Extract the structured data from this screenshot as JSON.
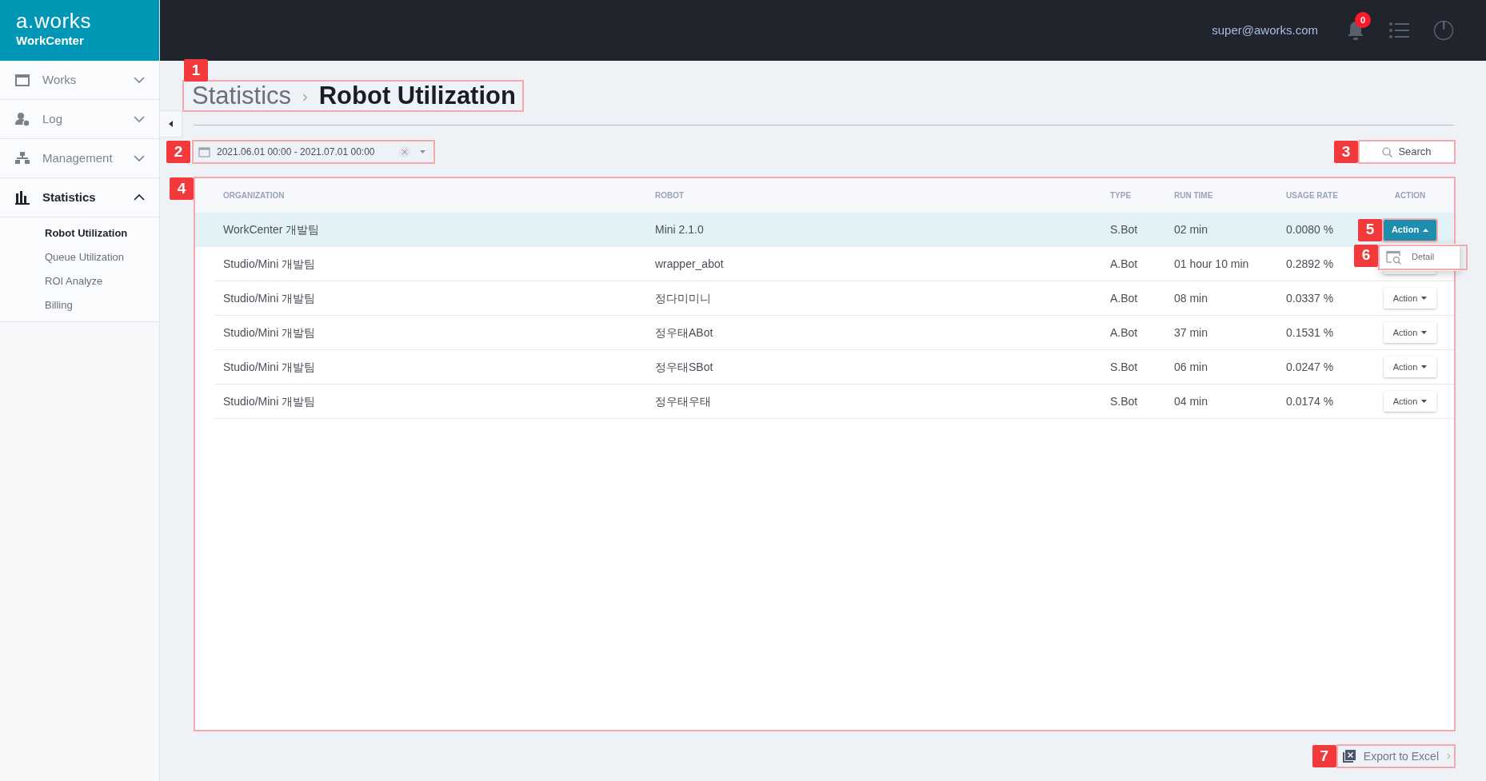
{
  "brand": {
    "logo": "a.works",
    "product": "WorkCenter"
  },
  "header": {
    "user": "super@aworks.com",
    "notifications": "0"
  },
  "sidebar": {
    "items": [
      {
        "label": "Works",
        "kind": "calendar",
        "expanded": false,
        "selected": false
      },
      {
        "label": "Log",
        "kind": "user",
        "expanded": false,
        "selected": false
      },
      {
        "label": "Management",
        "kind": "tree",
        "expanded": false,
        "selected": false
      },
      {
        "label": "Statistics",
        "kind": "chart",
        "expanded": true,
        "selected": true,
        "children": [
          {
            "label": "Robot Utilization",
            "selected": true
          },
          {
            "label": "Queue Utilization",
            "selected": false
          },
          {
            "label": "ROI Analyze",
            "selected": false
          },
          {
            "label": "Billing",
            "selected": false
          }
        ]
      }
    ]
  },
  "breadcrumb": {
    "parent": "Statistics",
    "separator": "›",
    "current": "Robot Utilization",
    "annotation": "1"
  },
  "date_range": {
    "value": "2021.06.01 00:00 - 2021.07.01 00:00",
    "annotation": "2"
  },
  "search_button": {
    "label": "Search",
    "annotation": "3"
  },
  "table": {
    "annotation": "4",
    "columns": [
      "ORGANIZATION",
      "ROBOT",
      "TYPE",
      "RUN TIME",
      "USAGE RATE",
      "ACTION"
    ],
    "rows": [
      {
        "cells": [
          "WorkCenter 개발팀",
          "Mini 2.1.0",
          "S.Bot",
          "02 min",
          "0.0080 %"
        ],
        "selected": true,
        "action": {
          "label": "Action",
          "expanded": true,
          "annotation": "5",
          "menu": [
            {
              "label": "Detail",
              "annotation": "6"
            }
          ]
        }
      },
      {
        "cells": [
          "Studio/Mini 개발팀",
          "wrapper_abot",
          "A.Bot",
          "01 hour 10 min",
          "0.2892 %"
        ],
        "selected": false,
        "action": {
          "expanded": false
        }
      },
      {
        "cells": [
          "Studio/Mini 개발팀",
          "정다미미니",
          "A.Bot",
          "08 min",
          "0.0337 %"
        ],
        "selected": false,
        "action": {
          "label": "Action",
          "expanded": false
        }
      },
      {
        "cells": [
          "Studio/Mini 개발팀",
          "정우태ABot",
          "A.Bot",
          "37 min",
          "0.1531 %"
        ],
        "selected": false,
        "action": {
          "label": "Action",
          "expanded": false
        }
      },
      {
        "cells": [
          "Studio/Mini 개발팀",
          "정우태SBot",
          "S.Bot",
          "06 min",
          "0.0247 %"
        ],
        "selected": false,
        "action": {
          "label": "Action",
          "expanded": false
        }
      },
      {
        "cells": [
          "Studio/Mini 개발팀",
          "정우태우태",
          "S.Bot",
          "04 min",
          "0.0174 %"
        ],
        "selected": false,
        "action": {
          "label": "Action",
          "expanded": false
        }
      }
    ]
  },
  "export_button": {
    "label": "Export to Excel",
    "annotation": "7"
  }
}
